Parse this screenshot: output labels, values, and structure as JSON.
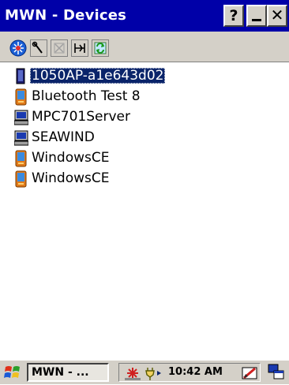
{
  "window": {
    "title": "MWN - Devices",
    "help_label": "?",
    "close_label": "✕"
  },
  "toolbar": {
    "icons": [
      "network-globe-icon",
      "wrench-icon",
      "disabled-x-icon",
      "connect-icon",
      "refresh-icon"
    ]
  },
  "devices": [
    {
      "name": "1050AP-a1e643d02",
      "icon": "access-point-icon",
      "selected": true
    },
    {
      "name": "Bluetooth Test 8",
      "icon": "pda-icon",
      "selected": false
    },
    {
      "name": "MPC701Server",
      "icon": "computer-icon",
      "selected": false
    },
    {
      "name": "SEAWIND",
      "icon": "computer-icon",
      "selected": false
    },
    {
      "name": "WindowsCE",
      "icon": "pda-icon",
      "selected": false
    },
    {
      "name": "WindowsCE",
      "icon": "pda-icon",
      "selected": false
    }
  ],
  "taskbar": {
    "task_label": "MWN - ...",
    "clock": "10:42 AM"
  }
}
